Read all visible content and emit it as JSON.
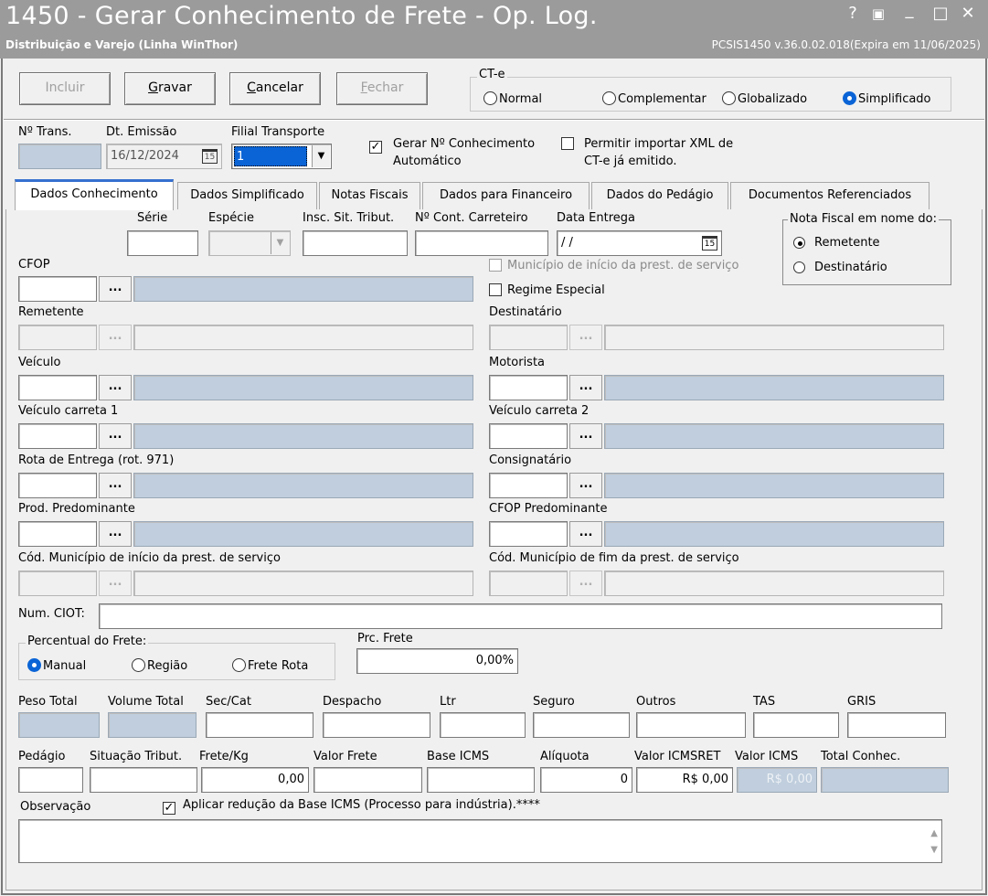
{
  "window": {
    "title": "1450 - Gerar Conhecimento de Frete - Op. Log.",
    "subtitle": "Distribuição e Varejo (Linha WinThor)",
    "version": "PCSIS1450  v.36.0.02.018(Expira em 11/06/2025)",
    "controls": {
      "help": "?",
      "restore": "▣",
      "minimize": "_",
      "maximize": "□",
      "close": "✕"
    }
  },
  "toolbar": {
    "incluir": "Incluir",
    "gravar": "Gravar",
    "cancelar": "Cancelar",
    "fechar": "Fechar"
  },
  "cte": {
    "legend": "CT-e",
    "options": {
      "normal": "Normal",
      "complementar": "Complementar",
      "globalizado": "Globalizado",
      "simplificado": "Simplificado"
    },
    "selected": "Simplificado"
  },
  "header": {
    "ntrans_label": "Nº Trans.",
    "dtemissao_label": "Dt. Emissão",
    "dtemissao_value": "16/12/2024",
    "filial_label": "Filial Transporte",
    "filial_value": "1",
    "gerar_label_1": "Gerar Nº Conhecimento",
    "gerar_label_2": "Automático",
    "gerar_checked": true,
    "permitir_label_1": "Permitir importar XML de",
    "permitir_label_2": "CT-e já emitido.",
    "permitir_checked": false
  },
  "tabs": [
    "Dados Conhecimento",
    "Dados Simplificado",
    "Notas Fiscais",
    "Dados para Financeiro",
    "Dados do Pedágio",
    "Documentos Referenciados"
  ],
  "form": {
    "serie": "Série",
    "especie": "Espécie",
    "insc": "Insc. Sit. Tribut.",
    "ncont": "Nº Cont. Carreteiro",
    "data_entrega": "Data Entrega",
    "data_entrega_value": " / /",
    "nota_fiscal_legend": "Nota Fiscal em nome do:",
    "remetente_opt": "Remetente",
    "destinatario_opt": "Destinatário",
    "cfop": "CFOP",
    "municipio_inicio": "Município de início da prest. de serviço",
    "regime_especial": "Regime Especial",
    "remetente": "Remetente",
    "destinatario": "Destinatário",
    "veiculo": "Veículo",
    "motorista": "Motorista",
    "veiculo_carreta_1": "Veículo carreta 1",
    "veiculo_carreta_2": "Veículo carreta 2",
    "rota_entrega": "Rota de Entrega (rot. 971)",
    "consignatario": "Consignatário",
    "prod_predominante": "Prod. Predominante",
    "cfop_predominante": "CFOP Predominante",
    "cod_mun_inicio": "Cód. Município de início da prest. de serviço",
    "cod_mun_fim": "Cód. Município de fim da prest. de serviço",
    "num_ciot": "Num. CIOT:",
    "percentual_legend": "Percentual do Frete:",
    "manual": "Manual",
    "regiao": "Região",
    "frete_rota": "Frete Rota",
    "prc_frete": "Prc. Frete",
    "prc_frete_value": "0,00%",
    "dots": "..."
  },
  "totals": {
    "peso_total": "Peso Total",
    "volume_total": "Volume Total",
    "sec_cat": "Sec/Cat",
    "despacho": "Despacho",
    "ltr": "Ltr",
    "seguro": "Seguro",
    "outros": "Outros",
    "tas": "TAS",
    "gris": "GRIS",
    "pedagio": "Pedágio",
    "situacao_tribut": "Situação Tribut.",
    "frete_kg": "Frete/Kg",
    "frete_kg_value": "0,00",
    "valor_frete": "Valor Frete",
    "base_icms": "Base ICMS",
    "aliquota": "Alíquota",
    "aliquota_value": "0",
    "valor_icmsret": "Valor ICMSRET",
    "valor_icmsret_value": "R$ 0,00",
    "valor_icms": "Valor ICMS",
    "valor_icms_value": "R$ 0,00",
    "total_conhec": "Total Conhec."
  },
  "obs": {
    "label": "Observação",
    "aplicar_label": "Aplicar redução da Base ICMS (Processo para indústria).****",
    "aplicar_checked": true
  },
  "colors": {
    "titlebar": "#9b9b9b",
    "readonly_field": "#c0cedd",
    "accent": "#0a64d6"
  }
}
